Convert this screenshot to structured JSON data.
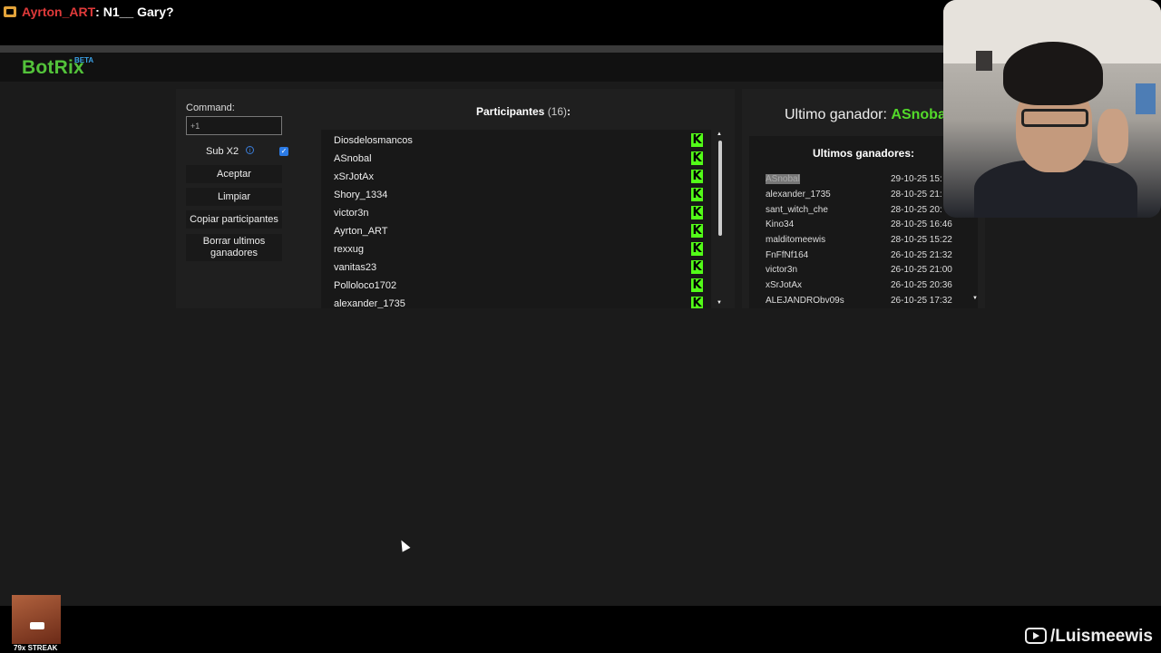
{
  "chat": {
    "user": "Ayrton_ART",
    "message": ": N1__ Gary?"
  },
  "app": {
    "logo": "BotRix",
    "beta": "BETA"
  },
  "controls": {
    "command_label": "Command:",
    "command_value": "+1",
    "sub_label": "Sub X2",
    "sub_checked": true,
    "accept": "Aceptar",
    "clear": "Limpiar",
    "copy": "Copiar participantes",
    "delete_winners": "Borrar ultimos ganadores"
  },
  "participants": {
    "title": "Participantes",
    "count": "(16)",
    "colon": ":",
    "platform_icon": "kick-icon",
    "items": [
      "Diosdelosmancos",
      "ASnobal",
      "xSrJotAx",
      "Shory_1334",
      "victor3n",
      "Ayrton_ART",
      "rexxug",
      "vanitas23",
      "Polloloco1702",
      "alexander_1735"
    ]
  },
  "winner": {
    "label": "Ultimo ganador: ",
    "name": "ASnobal"
  },
  "winners": {
    "title": "Ultimos ganadores:",
    "rows": [
      {
        "name": "ASnobal",
        "date": "29-10-25 15:"
      },
      {
        "name": "alexander_1735",
        "date": "28-10-25 21:"
      },
      {
        "name": "sant_witch_che",
        "date": "28-10-25 20:"
      },
      {
        "name": "Kino34",
        "date": "28-10-25 16:46"
      },
      {
        "name": "malditomeewis",
        "date": "28-10-25 15:22"
      },
      {
        "name": "FnFfNf164",
        "date": "26-10-25 21:32"
      },
      {
        "name": "victor3n",
        "date": "26-10-25 21:00"
      },
      {
        "name": "xSrJotAx",
        "date": "26-10-25 20:36"
      },
      {
        "name": "ALEJANDRObv09s",
        "date": "26-10-25 17:32"
      }
    ]
  },
  "overlay": {
    "streak": "79x STREAK",
    "channel": "/Luismeewis"
  },
  "colors": {
    "accent": "#53c23a",
    "winner": "#53d92a",
    "kick": "#53fc18",
    "chat_user": "#e03a3a"
  }
}
